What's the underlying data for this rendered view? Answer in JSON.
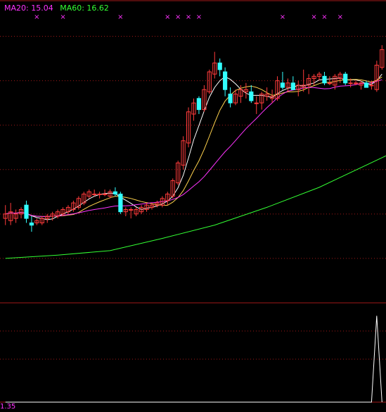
{
  "legend": {
    "ma20_text": "MA20: 15.04",
    "ma60_text": "MA60: 16.62",
    "ma20_color": "#ff33ff",
    "ma60_color": "#33ff33"
  },
  "lower_panel": {
    "bottom_value_text": "1.35"
  },
  "colors": {
    "background": "#000000",
    "grid": "#a01818",
    "up_candle": "#ff3b3b",
    "down_candle": "#33ffff",
    "ma_fast": "#ffffff",
    "ma_mid": "#ffd24d",
    "ma20": "#ff33ff",
    "ma60": "#33ff33",
    "signal_marker": "#ff33ff",
    "indicator": "#ffffff"
  },
  "chart_data": {
    "type": "candlestick",
    "title": "",
    "ylim": [
      10.0,
      23.0
    ],
    "grid": "horizontal dotted",
    "signal_marker_symbol": "×",
    "candles": [
      {
        "o": 13.8,
        "h": 14.4,
        "l": 13.5,
        "c": 14.0
      },
      {
        "o": 13.7,
        "h": 14.5,
        "l": 13.5,
        "c": 14.1
      },
      {
        "o": 13.8,
        "h": 14.2,
        "l": 13.6,
        "c": 14.0
      },
      {
        "o": 14.0,
        "h": 14.3,
        "l": 13.8,
        "c": 14.2
      },
      {
        "o": 14.4,
        "h": 14.6,
        "l": 13.6,
        "c": 13.8
      },
      {
        "o": 13.6,
        "h": 13.9,
        "l": 13.2,
        "c": 13.5
      },
      {
        "o": 13.6,
        "h": 13.8,
        "l": 13.5,
        "c": 13.7
      },
      {
        "o": 13.6,
        "h": 13.9,
        "l": 13.5,
        "c": 13.8
      },
      {
        "o": 13.8,
        "h": 14.0,
        "l": 13.6,
        "c": 13.9
      },
      {
        "o": 13.9,
        "h": 14.1,
        "l": 13.7,
        "c": 14.0
      },
      {
        "o": 13.9,
        "h": 14.2,
        "l": 13.8,
        "c": 14.1
      },
      {
        "o": 14.0,
        "h": 14.3,
        "l": 13.9,
        "c": 14.2
      },
      {
        "o": 14.1,
        "h": 14.4,
        "l": 14.0,
        "c": 14.3
      },
      {
        "o": 14.2,
        "h": 14.6,
        "l": 14.1,
        "c": 14.5
      },
      {
        "o": 14.3,
        "h": 14.8,
        "l": 14.2,
        "c": 14.7
      },
      {
        "o": 14.5,
        "h": 15.0,
        "l": 14.4,
        "c": 14.9
      },
      {
        "o": 14.8,
        "h": 15.1,
        "l": 14.7,
        "c": 15.0
      },
      {
        "o": 14.9,
        "h": 15.1,
        "l": 14.8,
        "c": 14.9
      },
      {
        "o": 14.9,
        "h": 15.0,
        "l": 14.7,
        "c": 14.9
      },
      {
        "o": 14.9,
        "h": 15.1,
        "l": 14.8,
        "c": 14.9
      },
      {
        "o": 14.8,
        "h": 15.1,
        "l": 14.7,
        "c": 15.0
      },
      {
        "o": 15.0,
        "h": 15.2,
        "l": 14.8,
        "c": 14.9
      },
      {
        "o": 14.9,
        "h": 15.0,
        "l": 14.0,
        "c": 14.1
      },
      {
        "o": 14.1,
        "h": 14.3,
        "l": 13.9,
        "c": 14.2
      },
      {
        "o": 14.2,
        "h": 14.3,
        "l": 13.8,
        "c": 14.2
      },
      {
        "o": 14.0,
        "h": 14.3,
        "l": 13.9,
        "c": 14.2
      },
      {
        "o": 14.1,
        "h": 14.4,
        "l": 14.0,
        "c": 14.3
      },
      {
        "o": 14.2,
        "h": 14.5,
        "l": 14.1,
        "c": 14.4
      },
      {
        "o": 14.3,
        "h": 14.5,
        "l": 14.2,
        "c": 14.4
      },
      {
        "o": 14.4,
        "h": 14.6,
        "l": 14.3,
        "c": 14.5
      },
      {
        "o": 14.4,
        "h": 14.8,
        "l": 14.3,
        "c": 14.7
      },
      {
        "o": 14.6,
        "h": 15.0,
        "l": 14.4,
        "c": 14.9
      },
      {
        "o": 14.8,
        "h": 15.6,
        "l": 14.7,
        "c": 15.5
      },
      {
        "o": 15.4,
        "h": 16.4,
        "l": 15.3,
        "c": 16.3
      },
      {
        "o": 16.2,
        "h": 17.5,
        "l": 16.0,
        "c": 17.3
      },
      {
        "o": 17.2,
        "h": 18.8,
        "l": 17.0,
        "c": 18.6
      },
      {
        "o": 18.5,
        "h": 19.2,
        "l": 18.2,
        "c": 19.0
      },
      {
        "o": 19.2,
        "h": 19.3,
        "l": 18.5,
        "c": 18.7
      },
      {
        "o": 18.7,
        "h": 19.8,
        "l": 18.6,
        "c": 19.6
      },
      {
        "o": 19.5,
        "h": 20.5,
        "l": 19.4,
        "c": 20.4
      },
      {
        "o": 20.3,
        "h": 21.3,
        "l": 20.1,
        "c": 20.8
      },
      {
        "o": 20.8,
        "h": 21.0,
        "l": 20.2,
        "c": 20.5
      },
      {
        "o": 20.4,
        "h": 20.6,
        "l": 19.3,
        "c": 19.6
      },
      {
        "o": 19.4,
        "h": 19.7,
        "l": 18.8,
        "c": 19.0
      },
      {
        "o": 19.0,
        "h": 19.6,
        "l": 18.9,
        "c": 19.4
      },
      {
        "o": 19.3,
        "h": 19.8,
        "l": 19.0,
        "c": 19.6
      },
      {
        "o": 19.5,
        "h": 19.9,
        "l": 19.2,
        "c": 19.6
      },
      {
        "o": 19.5,
        "h": 19.8,
        "l": 19.0,
        "c": 19.1
      },
      {
        "o": 19.0,
        "h": 19.3,
        "l": 18.5,
        "c": 19.0
      },
      {
        "o": 19.0,
        "h": 19.5,
        "l": 18.7,
        "c": 19.4
      },
      {
        "o": 19.3,
        "h": 19.7,
        "l": 19.1,
        "c": 19.4
      },
      {
        "o": 19.2,
        "h": 19.6,
        "l": 19.0,
        "c": 19.3
      },
      {
        "o": 19.2,
        "h": 20.2,
        "l": 19.1,
        "c": 20.0
      },
      {
        "o": 19.9,
        "h": 20.4,
        "l": 19.6,
        "c": 19.7
      },
      {
        "o": 19.7,
        "h": 20.1,
        "l": 19.5,
        "c": 19.9
      },
      {
        "o": 19.9,
        "h": 20.2,
        "l": 19.6,
        "c": 19.6
      },
      {
        "o": 19.6,
        "h": 20.0,
        "l": 19.3,
        "c": 19.8
      },
      {
        "o": 19.7,
        "h": 20.5,
        "l": 19.5,
        "c": 19.8
      },
      {
        "o": 19.8,
        "h": 20.3,
        "l": 19.4,
        "c": 20.1
      },
      {
        "o": 20.1,
        "h": 20.3,
        "l": 19.8,
        "c": 20.2
      },
      {
        "o": 20.2,
        "h": 20.4,
        "l": 20.0,
        "c": 20.3
      },
      {
        "o": 20.2,
        "h": 20.4,
        "l": 19.8,
        "c": 19.9
      },
      {
        "o": 19.9,
        "h": 20.2,
        "l": 19.8,
        "c": 19.9
      },
      {
        "o": 19.8,
        "h": 20.3,
        "l": 19.6,
        "c": 20.2
      },
      {
        "o": 20.1,
        "h": 20.4,
        "l": 19.9,
        "c": 20.3
      },
      {
        "o": 20.3,
        "h": 20.4,
        "l": 19.8,
        "c": 19.9
      },
      {
        "o": 19.9,
        "h": 20.1,
        "l": 19.7,
        "c": 19.9
      },
      {
        "o": 19.9,
        "h": 20.0,
        "l": 19.8,
        "c": 19.9
      },
      {
        "o": 19.8,
        "h": 20.0,
        "l": 19.6,
        "c": 19.9
      },
      {
        "o": 19.9,
        "h": 20.0,
        "l": 19.7,
        "c": 19.7
      },
      {
        "o": 19.8,
        "h": 20.0,
        "l": 19.6,
        "c": 19.8
      },
      {
        "o": 19.6,
        "h": 20.9,
        "l": 19.5,
        "c": 20.7
      },
      {
        "o": 20.6,
        "h": 21.6,
        "l": 20.5,
        "c": 21.4
      }
    ],
    "moving_averages": [
      {
        "key": "ma_fast",
        "period": 5
      },
      {
        "key": "ma_mid",
        "period": 10
      },
      {
        "key": "ma20",
        "period": 20
      },
      {
        "key": "ma60",
        "period": 60
      }
    ],
    "ma60_series": [
      [
        0,
        12.0
      ],
      [
        10,
        12.15
      ],
      [
        20,
        12.35
      ],
      [
        30,
        12.9
      ],
      [
        40,
        13.5
      ],
      [
        50,
        14.3
      ],
      [
        60,
        15.2
      ],
      [
        72,
        16.62
      ]
    ],
    "signal_marker_indices": [
      6,
      11,
      22,
      31,
      33,
      35,
      37,
      53,
      59,
      61,
      64
    ],
    "indicator": {
      "ylim": [
        0,
        10
      ],
      "values": [
        0,
        0,
        0,
        0,
        0,
        0,
        0,
        0,
        0,
        0,
        0,
        0,
        0,
        0,
        0,
        0,
        0,
        0,
        0,
        0,
        0,
        0,
        0,
        0,
        0,
        0,
        0,
        0,
        0,
        0,
        0,
        0,
        0,
        0,
        0,
        0,
        0,
        0,
        0,
        0,
        0,
        0,
        0,
        0,
        0,
        0,
        0,
        0,
        0,
        0,
        0,
        0,
        0,
        0,
        0,
        0,
        0,
        0,
        0,
        0,
        0,
        0,
        0,
        0,
        0,
        0,
        0,
        0,
        0,
        0,
        0,
        9.5,
        0
      ]
    }
  }
}
